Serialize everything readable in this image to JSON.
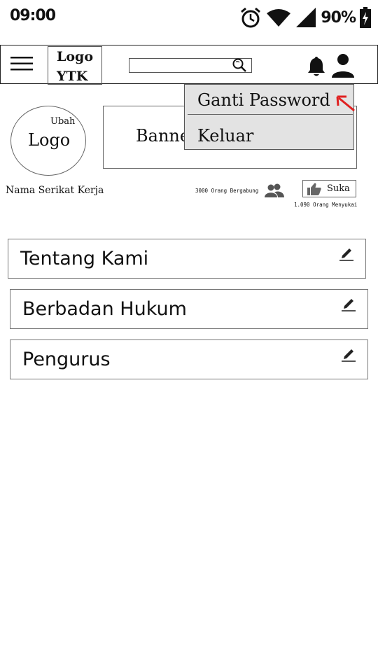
{
  "status_bar": {
    "time": "09:00",
    "battery": "90%",
    "icons": [
      "alarm-icon",
      "wifi-icon",
      "signal-icon",
      "battery-charging-icon"
    ]
  },
  "app_bar": {
    "logo_line1": "Logo",
    "logo_line2": "YTK",
    "search_placeholder": "",
    "icons": [
      "menu-icon",
      "search-icon",
      "bell-icon",
      "user-icon"
    ]
  },
  "profile": {
    "logo_edit": "Ubah",
    "logo_text": "Logo",
    "banner_text": "Banner",
    "union_name": "Nama Serikat Kerja",
    "members_count": "3000 Orang Bergabung",
    "like_label": "Suka",
    "likes_count": "1.090 Orang Menyukai"
  },
  "sections": [
    {
      "title": "Tentang Kami"
    },
    {
      "title": "Berbadan Hukum"
    },
    {
      "title": "Pengurus"
    }
  ],
  "dropdown": {
    "items": [
      "Ganti Password",
      "Keluar"
    ]
  },
  "colors": {
    "dropdown_bg": "#e3e3e3",
    "pointer_arrow": "#e02020",
    "icon_dark": "#111111"
  }
}
